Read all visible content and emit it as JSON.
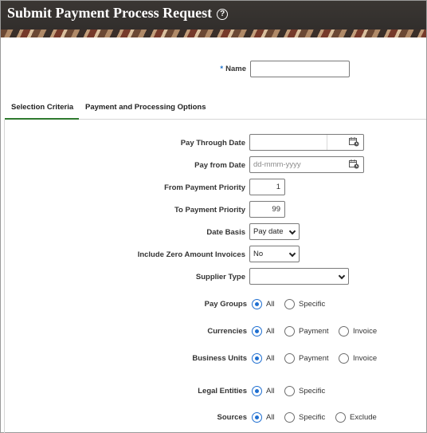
{
  "header": {
    "title": "Submit Payment Process Request"
  },
  "name_field": {
    "label": "Name",
    "value": ""
  },
  "tabs": [
    {
      "label": "Selection Criteria",
      "selected": true
    },
    {
      "label": "Payment and Processing Options",
      "selected": false
    }
  ],
  "fields": {
    "pay_through_date": {
      "label": "Pay Through Date",
      "value": ""
    },
    "pay_from_date": {
      "label": "Pay from Date",
      "placeholder": "dd-mmm-yyyy"
    },
    "from_priority": {
      "label": "From Payment Priority",
      "value": "1"
    },
    "to_priority": {
      "label": "To Payment Priority",
      "value": "99"
    },
    "date_basis": {
      "label": "Date Basis",
      "value": "Pay date"
    },
    "zero_amount": {
      "label": "Include Zero Amount Invoices",
      "value": "No"
    },
    "supplier_type": {
      "label": "Supplier Type",
      "value": ""
    }
  },
  "radio_groups": {
    "pay_groups": {
      "label": "Pay Groups",
      "options": [
        "All",
        "Specific"
      ],
      "selected": "All"
    },
    "currencies": {
      "label": "Currencies",
      "options": [
        "All",
        "Payment",
        "Invoice"
      ],
      "selected": "All"
    },
    "business_units": {
      "label": "Business Units",
      "options": [
        "All",
        "Payment",
        "Invoice"
      ],
      "selected": "All"
    },
    "legal_entities": {
      "label": "Legal Entities",
      "options": [
        "All",
        "Specific"
      ],
      "selected": "All"
    },
    "sources": {
      "label": "Sources",
      "options": [
        "All",
        "Specific",
        "Exclude"
      ],
      "selected": "All"
    }
  },
  "colors": {
    "header_bg": "#2f2c2a",
    "accent_blue": "#1f6fd1",
    "tab_underline": "#2f7a2f"
  }
}
